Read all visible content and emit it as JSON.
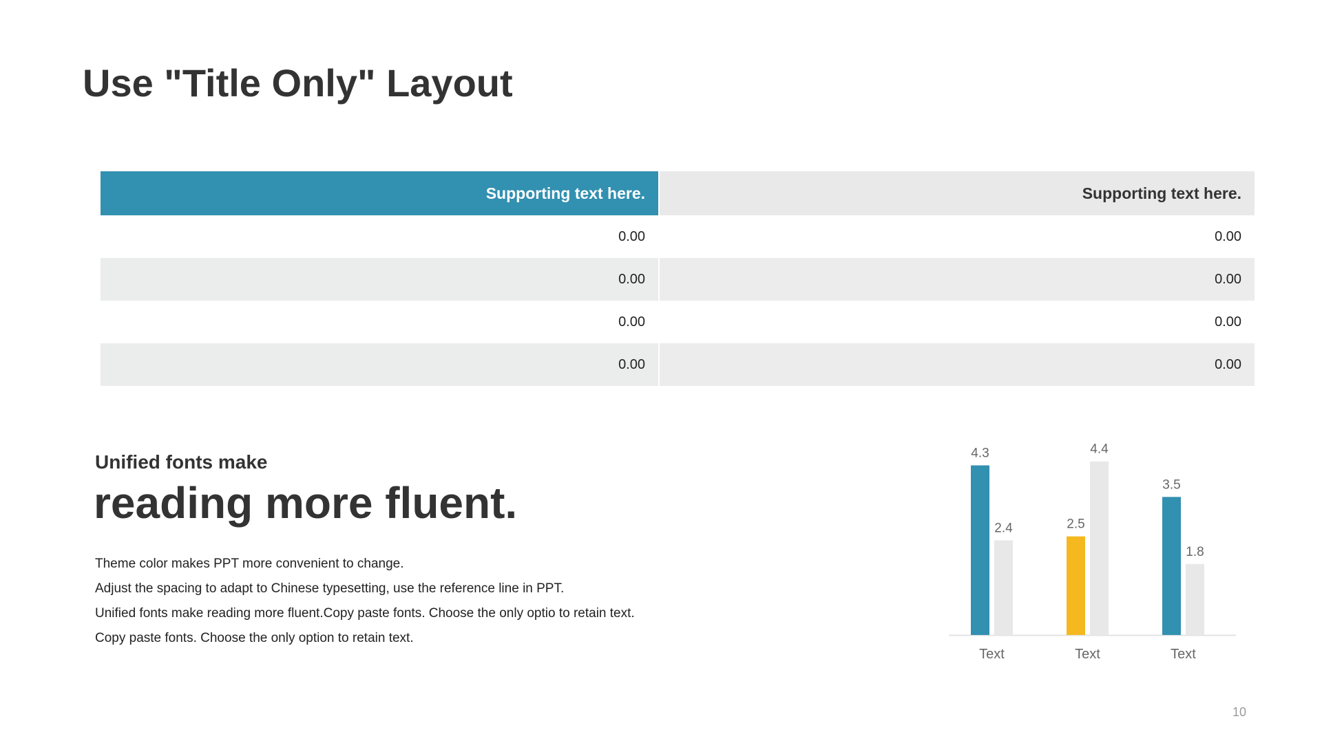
{
  "slide": {
    "title": "Use \"Title Only\" Layout",
    "page_number": "10"
  },
  "table": {
    "headers": [
      "Supporting text here.",
      "Supporting text here."
    ],
    "rows": [
      [
        "0.00",
        "0.00"
      ],
      [
        "0.00",
        "0.00"
      ],
      [
        "0.00",
        "0.00"
      ],
      [
        "0.00",
        "0.00"
      ]
    ]
  },
  "text_block": {
    "subhead": "Unified fonts make",
    "headline": "reading more fluent.",
    "lines": [
      "Theme color makes PPT more convenient  to change.",
      "Adjust the spacing to adapt to Chinese  typesetting, use the reference line in PPT.",
      "Unified  fonts make reading more fluent.Copy paste fonts. Choose the only optio to retain text.",
      "Copy paste  fonts. Choose the only option to retain text."
    ]
  },
  "colors": {
    "accent": "#3290b0",
    "highlight": "#f5b81f",
    "secondary": "#e8e8e8",
    "text": "#333333"
  },
  "chart_data": {
    "type": "bar",
    "categories": [
      "Text",
      "Text",
      "Text"
    ],
    "series": [
      {
        "values": [
          4.3,
          2.5,
          3.5
        ],
        "colors": [
          "#3290b0",
          "#f5b81f",
          "#3290b0"
        ]
      },
      {
        "values": [
          2.4,
          4.4,
          1.8
        ],
        "colors": [
          "#e8e8e8",
          "#e8e8e8",
          "#e8e8e8"
        ]
      }
    ],
    "ylim": [
      0,
      4.5
    ],
    "grid": false,
    "legend": "none",
    "data_labels": true
  }
}
